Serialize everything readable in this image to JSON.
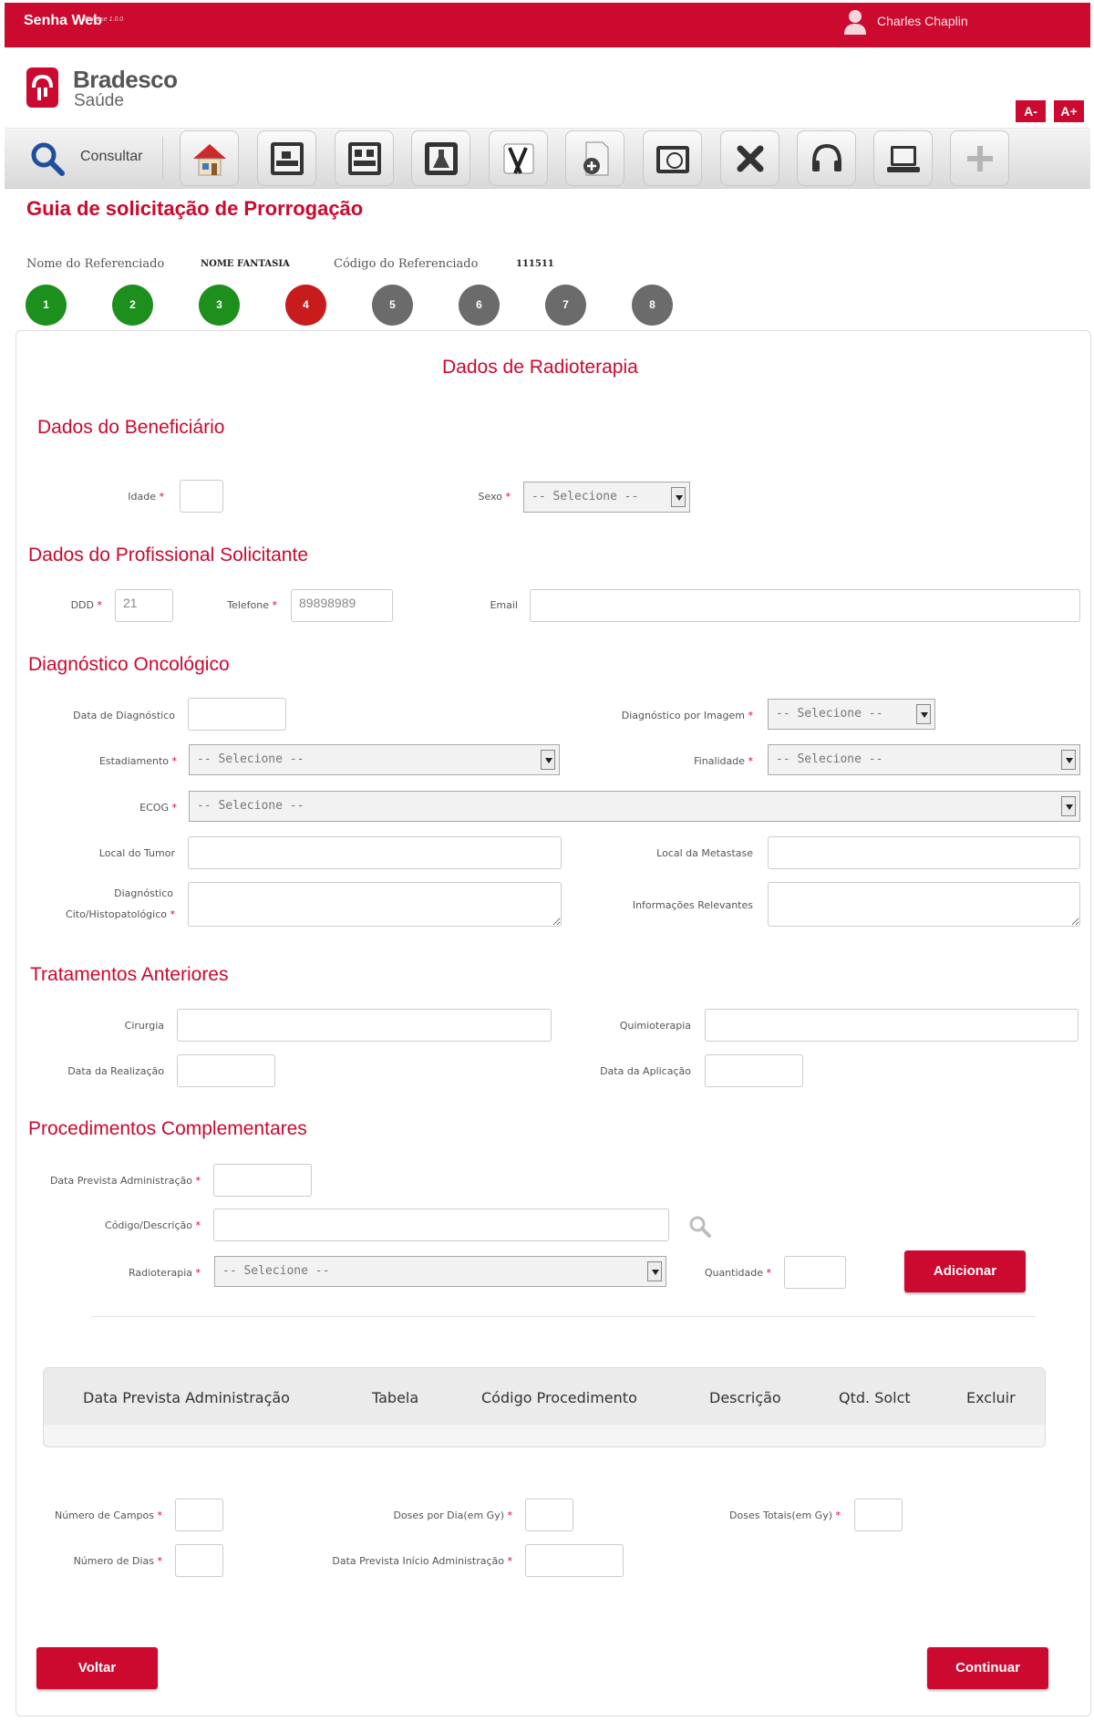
{
  "header": {
    "app_name": "Senha Web",
    "release": "Release 1.0.0",
    "user_name": "Charles Chaplin",
    "brand_title": "Bradesco",
    "brand_sub": "Saúde",
    "font_decrease": "A-",
    "font_increase": "A+"
  },
  "toolbar": {
    "consult_label": "Consultar",
    "icons": [
      "home-icon",
      "hospital-bed-icon",
      "hospital-bed-group-icon",
      "lab-flask-icon",
      "surgical-instruments-icon",
      "add-document-icon",
      "monitor-icon",
      "close-icon",
      "headset-icon",
      "laptop-icon",
      "plus-icon"
    ]
  },
  "page": {
    "title": "Guia de solicitação de Prorrogação",
    "ref_name_label": "Nome do Referenciado",
    "ref_name_value": "NOME FANTASIA",
    "ref_code_label": "Código do Referenciado",
    "ref_code_value": "111511",
    "steps": [
      "1",
      "2",
      "3",
      "4",
      "5",
      "6",
      "7",
      "8"
    ],
    "current_step": 4
  },
  "form": {
    "title": "Dados de Radioterapia",
    "beneficiario": {
      "heading": "Dados do Beneficiário",
      "idade_label": "Idade",
      "sexo_label": "Sexo",
      "sexo_value": "-- Selecione --"
    },
    "profissional": {
      "heading": "Dados do Profissional Solicitante",
      "ddd_label": "DDD",
      "ddd_value": "21",
      "telefone_label": "Telefone",
      "telefone_value": "89898989",
      "email_label": "Email"
    },
    "diagnostico": {
      "heading": "Diagnóstico Oncológico",
      "data_label": "Data de Diagnóstico",
      "imagem_label": "Diagnóstico por Imagem",
      "imagem_value": "-- Selecione --",
      "estadiamento_label": "Estadiamento",
      "estadiamento_value": "-- Selecione --",
      "finalidade_label": "Finalidade",
      "finalidade_value": "-- Selecione --",
      "ecog_label": "ECOG",
      "ecog_value": "-- Selecione --",
      "local_tumor_label": "Local do Tumor",
      "local_metastase_label": "Local da Metastase",
      "cito_label_1": "Diagnóstico",
      "cito_label_2": "Cito/Histopatológico",
      "info_label": "Informações Relevantes"
    },
    "tratamentos": {
      "heading": "Tratamentos Anteriores",
      "cirurgia_label": "Cirurgia",
      "quimio_label": "Quimioterapia",
      "data_realizacao_label": "Data da Realização",
      "data_aplicacao_label": "Data da Aplicação"
    },
    "procedimentos": {
      "heading": "Procedimentos Complementares",
      "data_prevista_label": "Data Prevista Administração",
      "codigo_label": "Código/Descrição",
      "radioterapia_label": "Radioterapia",
      "radioterapia_value": "-- Selecione --",
      "quantidade_label": "Quantidade",
      "adicionar": "Adicionar"
    },
    "table": {
      "columns": [
        "Data Prevista Administração",
        "Tabela",
        "Código Procedimento",
        "Descrição",
        "Qtd. Solct",
        "Excluir"
      ]
    },
    "final": {
      "num_campos_label": "Número de Campos",
      "doses_dia_label": "Doses por Dia(em Gy)",
      "doses_totais_label": "Doses Totais(em Gy)",
      "num_dias_label": "Número de Dias",
      "data_inicio_label": "Data Prevista Início Administração"
    },
    "voltar": "Voltar",
    "continuar": "Continuar"
  }
}
